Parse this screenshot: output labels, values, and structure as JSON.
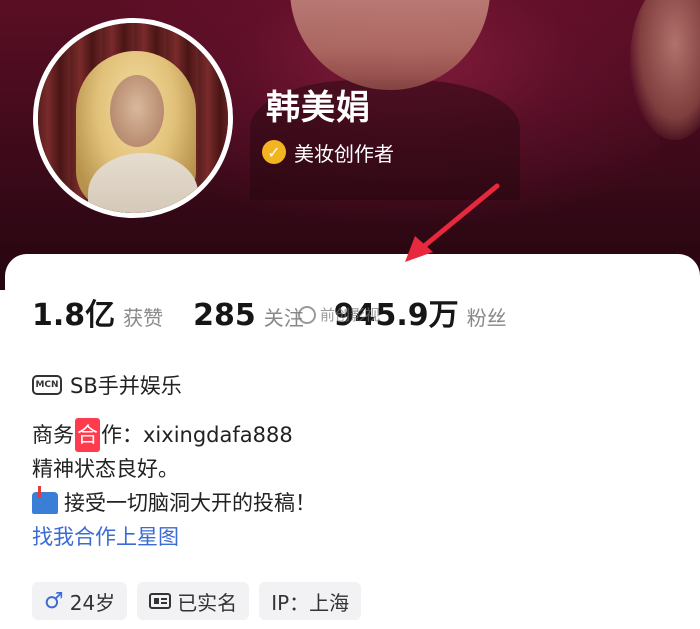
{
  "profile": {
    "name": "韩美娟",
    "verified_label": "美妆创作者",
    "verified_icon": "check-badge-icon"
  },
  "stats": [
    {
      "num": "1.8亿",
      "label": "获赞"
    },
    {
      "num": "285",
      "label": "关注"
    },
    {
      "num": "945.9万",
      "label": "粉丝"
    }
  ],
  "watermark": "前创影视",
  "mcn": {
    "icon_text": "MCN",
    "text": "SB手并娱乐"
  },
  "bio": {
    "biz_prefix": "商务",
    "biz_highlight": "合",
    "biz_suffix": "作：xixingdafa888",
    "line2": "精神状态良好。",
    "line3": "接受一切脑洞大开的投稿！",
    "line4": "找我合作上星图"
  },
  "tags": {
    "age": "24岁",
    "realname": "已实名",
    "ip": "IP：上海"
  },
  "colors": {
    "banner": "#3d0a1a",
    "verified": "#f2b41f",
    "link": "#3c6bd6",
    "highlight": "#ff3b4d",
    "arrow": "#e8283c"
  }
}
